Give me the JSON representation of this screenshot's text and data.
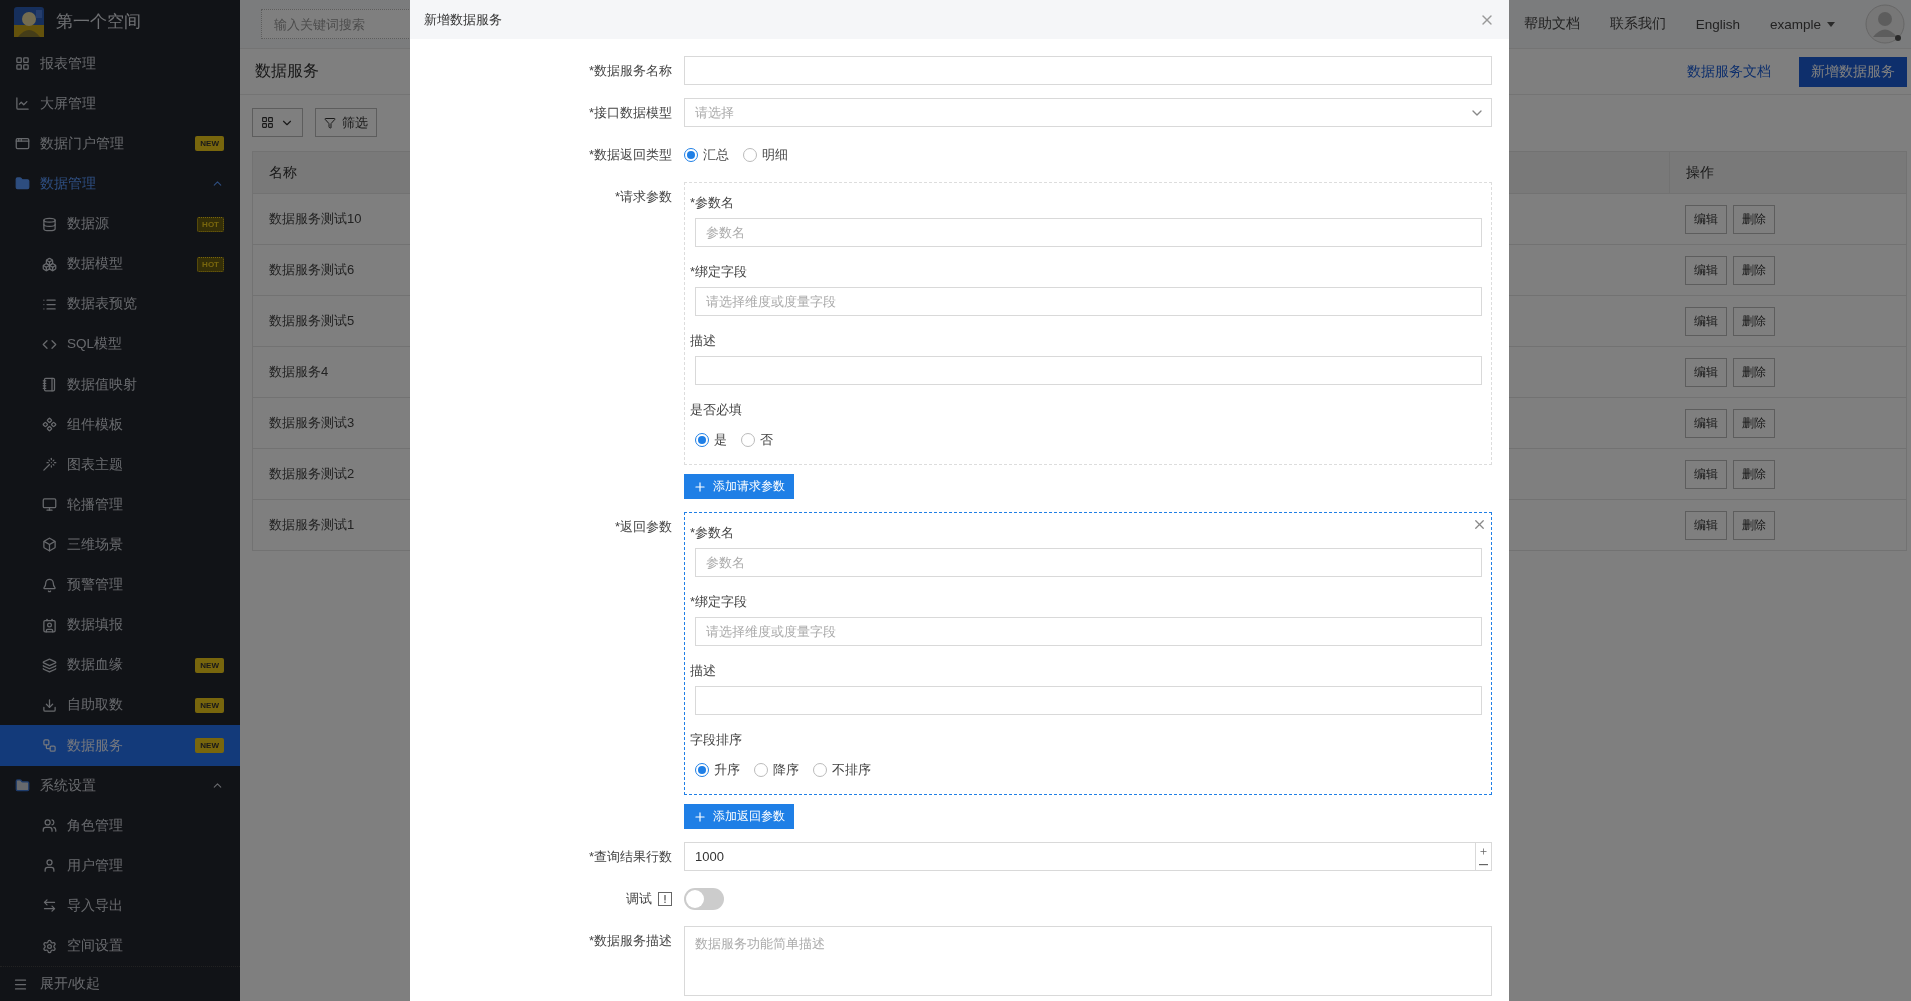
{
  "sidebar": {
    "space_name": "第一个空间",
    "items": [
      {
        "label": "报表管理"
      },
      {
        "label": "大屏管理"
      },
      {
        "label": "数据门户管理",
        "badge": {
          "text": "NEW",
          "kind": "filled"
        }
      },
      {
        "label": "数据管理",
        "expanded": true,
        "children": [
          {
            "label": "数据源",
            "badge": {
              "text": "HOT",
              "kind": "outlined"
            },
            "selected": false
          },
          {
            "label": "数据模型",
            "badge": {
              "text": "HOT",
              "kind": "outlined"
            },
            "selected": false
          },
          {
            "label": "数据表预览",
            "selected": false
          },
          {
            "label": "SQL模型",
            "selected": false
          },
          {
            "label": "数据值映射",
            "selected": false
          },
          {
            "label": "组件模板",
            "selected": false
          },
          {
            "label": "图表主题",
            "selected": false
          },
          {
            "label": "轮播管理",
            "selected": false
          },
          {
            "label": "三维场景",
            "selected": false
          },
          {
            "label": "预警管理",
            "selected": false
          },
          {
            "label": "数据填报",
            "selected": false
          },
          {
            "label": "数据血缘",
            "badge": {
              "text": "NEW",
              "kind": "filled"
            },
            "selected": false
          },
          {
            "label": "自助取数",
            "badge": {
              "text": "NEW",
              "kind": "filled"
            },
            "selected": false
          },
          {
            "label": "数据服务",
            "badge": {
              "text": "NEW",
              "kind": "filled"
            },
            "selected": true
          }
        ]
      },
      {
        "label": "系统设置",
        "expanded": true,
        "children": [
          {
            "label": "角色管理",
            "selected": false
          },
          {
            "label": "用户管理",
            "selected": false
          },
          {
            "label": "导入导出",
            "selected": false
          },
          {
            "label": "空间设置",
            "selected": false
          }
        ]
      }
    ],
    "collapse_label": "展开/收起"
  },
  "header": {
    "search": {
      "placeholder": "输入关键词搜索"
    },
    "links": [
      "帮助文档",
      "联系我们",
      "English"
    ],
    "user": "example"
  },
  "page": {
    "title": "数据服务",
    "doc_link": "数据服务文档",
    "add_button": "新增数据服务",
    "filter_button": "筛选",
    "table": {
      "columns": [
        "名称",
        "操作"
      ],
      "rows": [
        {
          "name": "数据服务测试10",
          "actions": [
            "编辑",
            "删除"
          ]
        },
        {
          "name": "数据服务测试6",
          "actions": [
            "编辑",
            "删除"
          ]
        },
        {
          "name": "数据服务测试5",
          "actions": [
            "编辑",
            "删除"
          ]
        },
        {
          "name": "数据服务4",
          "actions": [
            "编辑",
            "删除"
          ]
        },
        {
          "name": "数据服务测试3",
          "actions": [
            "编辑",
            "删除"
          ]
        },
        {
          "name": "数据服务测试2",
          "actions": [
            "编辑",
            "删除"
          ]
        },
        {
          "name": "数据服务测试1",
          "actions": [
            "编辑",
            "删除"
          ]
        }
      ]
    }
  },
  "dialog": {
    "title": "新增数据服务",
    "fields": [
      {
        "kind": "text",
        "label": "*数据服务名称"
      },
      {
        "kind": "select",
        "label": "*接口数据模型",
        "placeholder": "请选择"
      },
      {
        "kind": "radio",
        "label": "*数据返回类型",
        "options": [
          {
            "label": "汇总",
            "selected": true
          },
          {
            "label": "明细",
            "selected": false
          }
        ]
      },
      {
        "kind": "params",
        "label": "*请求参数",
        "highlighted": false,
        "add_button": "添加请求参数",
        "fields": [
          {
            "kind": "text",
            "label": "*参数名",
            "placeholder": "参数名"
          },
          {
            "kind": "text",
            "label": "*绑定字段",
            "placeholder": "请选择维度或度量字段"
          },
          {
            "kind": "text",
            "label": "描述"
          },
          {
            "kind": "radio",
            "label": "是否必填",
            "options": [
              {
                "label": "是",
                "selected": true
              },
              {
                "label": "否",
                "selected": false
              }
            ]
          }
        ]
      },
      {
        "kind": "params",
        "label": "*返回参数",
        "highlighted": true,
        "add_button": "添加返回参数",
        "fields": [
          {
            "kind": "text",
            "label": "*参数名",
            "placeholder": "参数名"
          },
          {
            "kind": "text",
            "label": "*绑定字段",
            "placeholder": "请选择维度或度量字段"
          },
          {
            "kind": "text",
            "label": "描述"
          },
          {
            "kind": "radio",
            "label": "字段排序",
            "options": [
              {
                "label": "升序",
                "selected": true
              },
              {
                "label": "降序",
                "selected": false
              },
              {
                "label": "不排序",
                "selected": false
              }
            ]
          }
        ]
      },
      {
        "kind": "number",
        "label": "*查询结果行数",
        "value": "1000"
      },
      {
        "kind": "switch",
        "label": "调试",
        "on": false
      },
      {
        "kind": "textarea",
        "label": "*数据服务描述",
        "placeholder": "数据服务功能简单描述"
      }
    ]
  }
}
